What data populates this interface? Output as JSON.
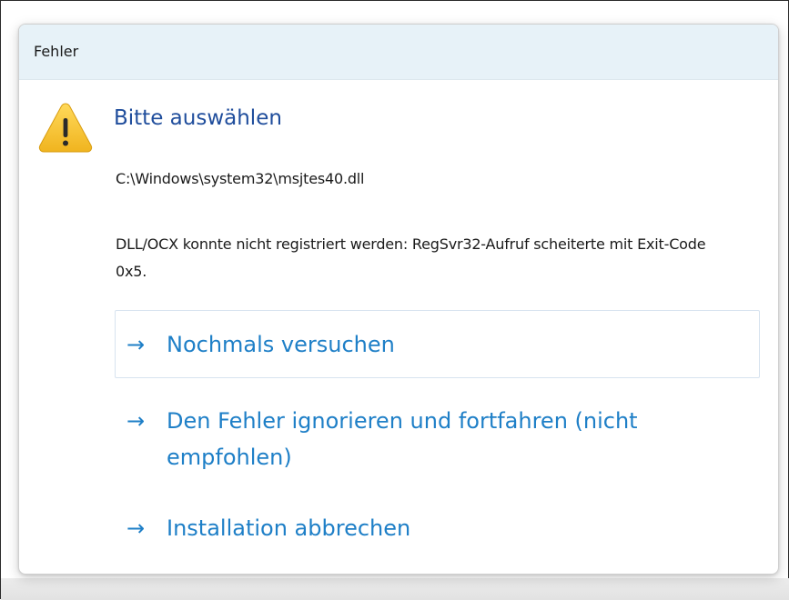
{
  "dialog": {
    "title": "Fehler",
    "heading": "Bitte auswählen",
    "path": "C:\\Windows\\system32\\msjtes40.dll",
    "message": "DLL/OCX konnte nicht registriert werden: RegSvr32-Aufruf scheiterte mit Exit-Code 0x5.",
    "icon": "warning-icon",
    "commands": [
      {
        "arrow": "→",
        "label": "Nochmals versuchen"
      },
      {
        "arrow": "→",
        "label": "Den Fehler ignorieren und fortfahren (nicht empfohlen)"
      },
      {
        "arrow": "→",
        "label": "Installation abbrechen"
      }
    ]
  },
  "colors": {
    "heading": "#1f4d9c",
    "command_link": "#1e7fc7",
    "titlebar": "#e7f2f8",
    "warning_fill": "#f5c331"
  }
}
